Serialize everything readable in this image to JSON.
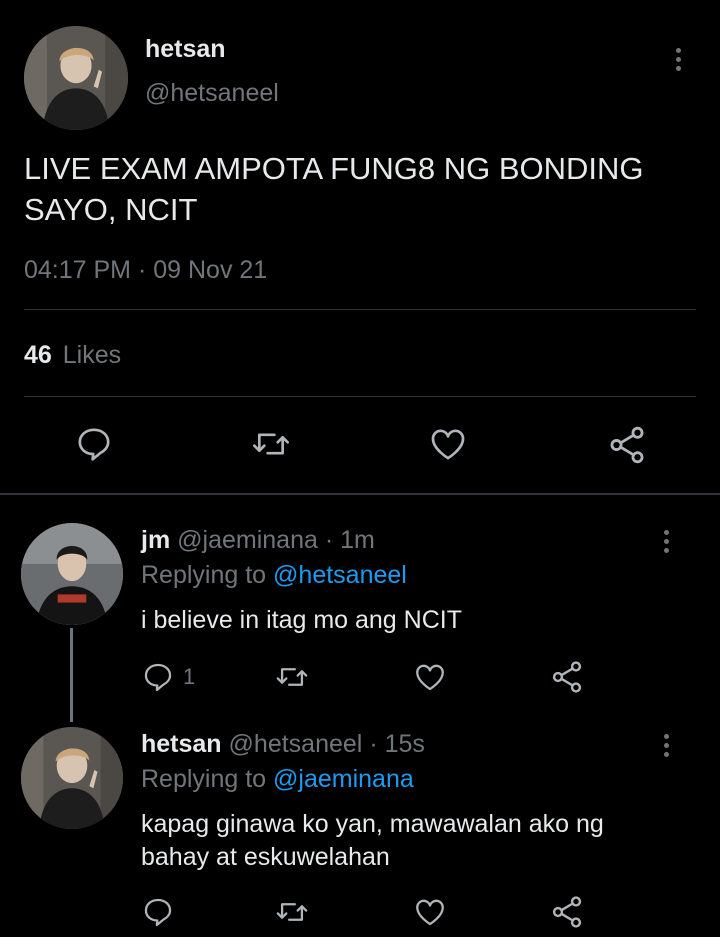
{
  "main_tweet": {
    "display_name": "hetsan",
    "handle": "@hetsaneel",
    "text_line1": "LIVE EXAM AMPOTA FUNG8 NG BONDING",
    "text_line2": "SAYO, NCIT",
    "time": "04:17 PM",
    "separator": "·",
    "date": "09 Nov 21",
    "likes_count": "46",
    "likes_label": "Likes"
  },
  "replies": [
    {
      "display_name": "jm",
      "handle": "@jaeminana",
      "separator": "·",
      "time": "1m",
      "replying_prefix": "Replying to",
      "replying_to": "@hetsaneel",
      "text_line1": "i believe in itag mo ang NCIT",
      "text_line2": "",
      "reply_count": "1"
    },
    {
      "display_name": "hetsan",
      "handle": "@hetsaneel",
      "separator": "·",
      "time": "15s",
      "replying_prefix": "Replying to",
      "replying_to": "@jaeminana",
      "text_line1": "kapag ginawa ko yan, mawawalan ako ng",
      "text_line2": "bahay at eskuwelahan",
      "reply_count": ""
    }
  ],
  "icons": [
    "reply-icon",
    "retweet-icon",
    "like-icon",
    "share-icon",
    "more-icon"
  ],
  "colors": {
    "background": "#000000",
    "text": "#e7e9ea",
    "muted": "#71767b",
    "link": "#1d9bf0",
    "divider": "#2f3336"
  }
}
